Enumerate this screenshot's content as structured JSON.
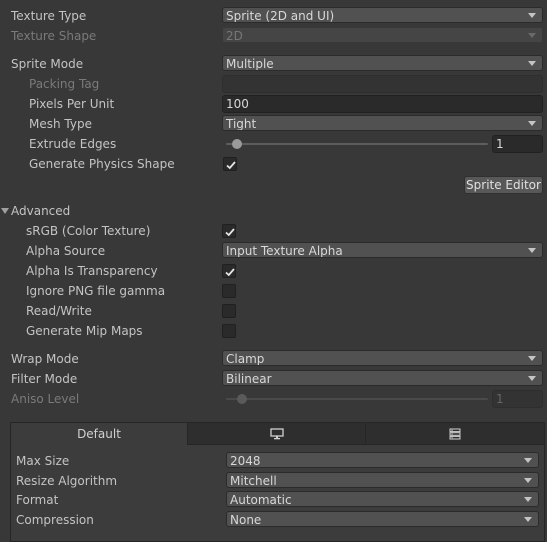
{
  "texture_type": {
    "label": "Texture Type",
    "value": "Sprite (2D and UI)"
  },
  "texture_shape": {
    "label": "Texture Shape",
    "value": "2D"
  },
  "sprite_mode": {
    "label": "Sprite Mode",
    "value": "Multiple"
  },
  "packing_tag": {
    "label": "Packing Tag",
    "value": ""
  },
  "pixels_per_unit": {
    "label": "Pixels Per Unit",
    "value": "100"
  },
  "mesh_type": {
    "label": "Mesh Type",
    "value": "Tight"
  },
  "extrude_edges": {
    "label": "Extrude Edges",
    "value": "1"
  },
  "generate_physics_shape": {
    "label": "Generate Physics Shape",
    "checked": true
  },
  "sprite_editor_button": "Sprite Editor",
  "advanced": {
    "label": "Advanced",
    "srgb": {
      "label": "sRGB (Color Texture)",
      "checked": true
    },
    "alpha_source": {
      "label": "Alpha Source",
      "value": "Input Texture Alpha"
    },
    "alpha_is_transparency": {
      "label": "Alpha Is Transparency",
      "checked": true
    },
    "ignore_png_gamma": {
      "label": "Ignore PNG file gamma",
      "checked": false
    },
    "read_write": {
      "label": "Read/Write",
      "checked": false
    },
    "generate_mip_maps": {
      "label": "Generate Mip Maps",
      "checked": false
    }
  },
  "wrap_mode": {
    "label": "Wrap Mode",
    "value": "Clamp"
  },
  "filter_mode": {
    "label": "Filter Mode",
    "value": "Bilinear"
  },
  "aniso_level": {
    "label": "Aniso Level",
    "value": "1"
  },
  "platform_tabs": {
    "default_label": "Default",
    "tab2_icon": "monitor-icon",
    "tab3_icon": "server-icon"
  },
  "platform_settings": {
    "max_size": {
      "label": "Max Size",
      "value": "2048"
    },
    "resize_algorithm": {
      "label": "Resize Algorithm",
      "value": "Mitchell"
    },
    "format": {
      "label": "Format",
      "value": "Automatic"
    },
    "compression": {
      "label": "Compression",
      "value": "None"
    }
  }
}
